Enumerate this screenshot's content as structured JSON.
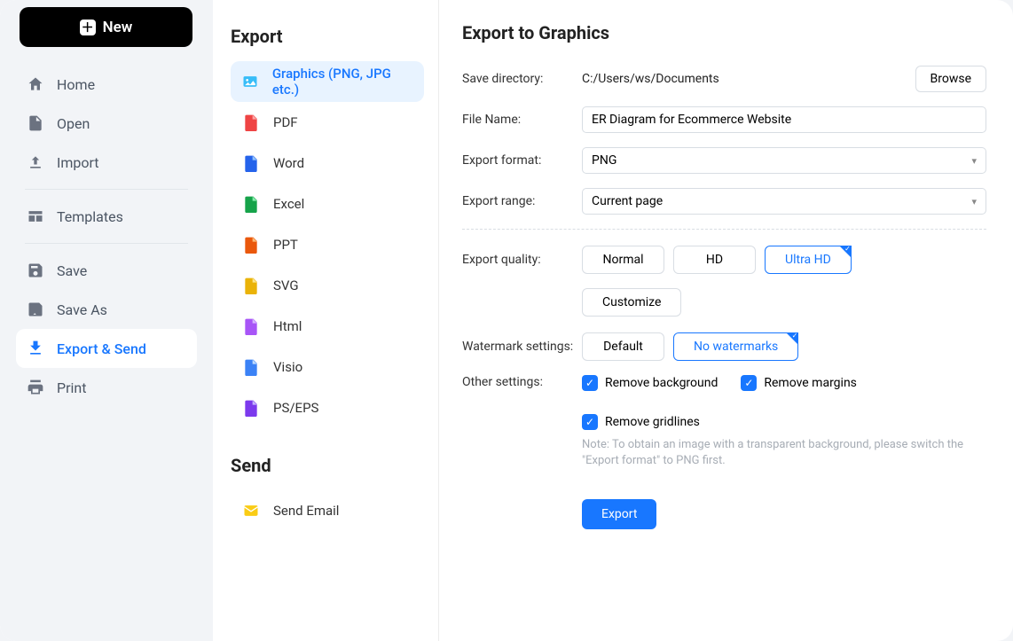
{
  "new_button": "New",
  "nav": {
    "home": "Home",
    "open": "Open",
    "import": "Import",
    "templates": "Templates",
    "save": "Save",
    "save_as": "Save As",
    "export_send": "Export & Send",
    "print": "Print"
  },
  "middle": {
    "export_title": "Export",
    "send_title": "Send",
    "options": {
      "graphics": "Graphics (PNG, JPG etc.)",
      "pdf": "PDF",
      "word": "Word",
      "excel": "Excel",
      "ppt": "PPT",
      "svg": "SVG",
      "html": "Html",
      "visio": "Visio",
      "pseps": "PS/EPS"
    },
    "send_email": "Send Email"
  },
  "right": {
    "title": "Export to Graphics",
    "save_dir_label": "Save directory:",
    "save_dir_value": "C:/Users/ws/Documents",
    "browse": "Browse",
    "file_name_label": "File Name:",
    "file_name_value": "ER Diagram for Ecommerce Website",
    "format_label": "Export format:",
    "format_value": "PNG",
    "range_label": "Export range:",
    "range_value": "Current page",
    "quality_label": "Export quality:",
    "quality_normal": "Normal",
    "quality_hd": "HD",
    "quality_uhd": "Ultra HD",
    "quality_customize": "Customize",
    "watermark_label": "Watermark settings:",
    "watermark_default": "Default",
    "watermark_none": "No watermarks",
    "other_label": "Other settings:",
    "remove_bg": "Remove background",
    "remove_margins": "Remove margins",
    "remove_gridlines": "Remove gridlines",
    "note": "Note: To obtain an image with a transparent background, please switch the \"Export format\" to PNG first.",
    "export_btn": "Export"
  }
}
